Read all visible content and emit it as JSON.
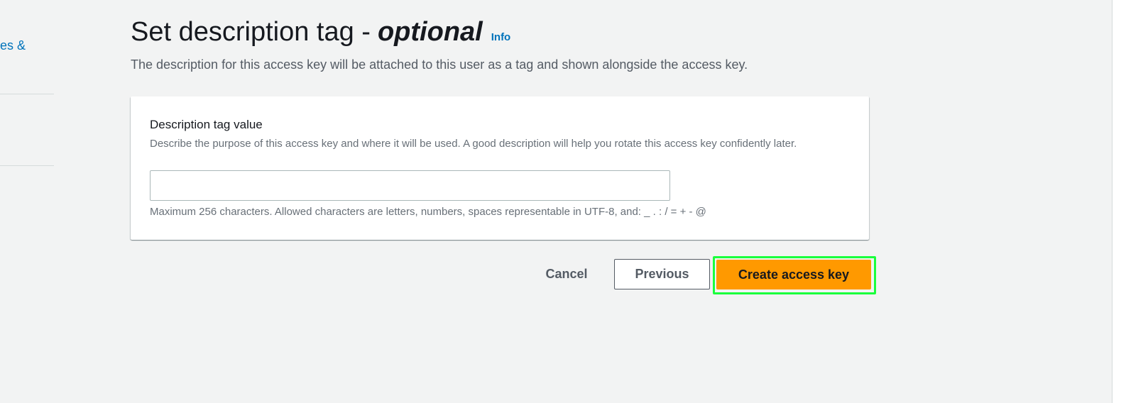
{
  "sidebar": {
    "partial_link": "es &"
  },
  "header": {
    "title": "Set description tag -",
    "title_optional": "optional",
    "info_link": "Info",
    "description": "The description for this access key will be attached to this user as a tag and shown alongside the access key."
  },
  "form": {
    "field_label": "Description tag value",
    "field_description": "Describe the purpose of this access key and where it will be used. A good description will help you rotate this access key confidently later.",
    "field_value": "",
    "field_constraint": "Maximum 256 characters. Allowed characters are letters, numbers, spaces representable in UTF-8, and: _ . : / = + - @"
  },
  "actions": {
    "cancel_label": "Cancel",
    "previous_label": "Previous",
    "create_label": "Create access key"
  },
  "colors": {
    "primary_button": "#ff9900",
    "link": "#0073bb",
    "highlight": "#1aff3c"
  }
}
